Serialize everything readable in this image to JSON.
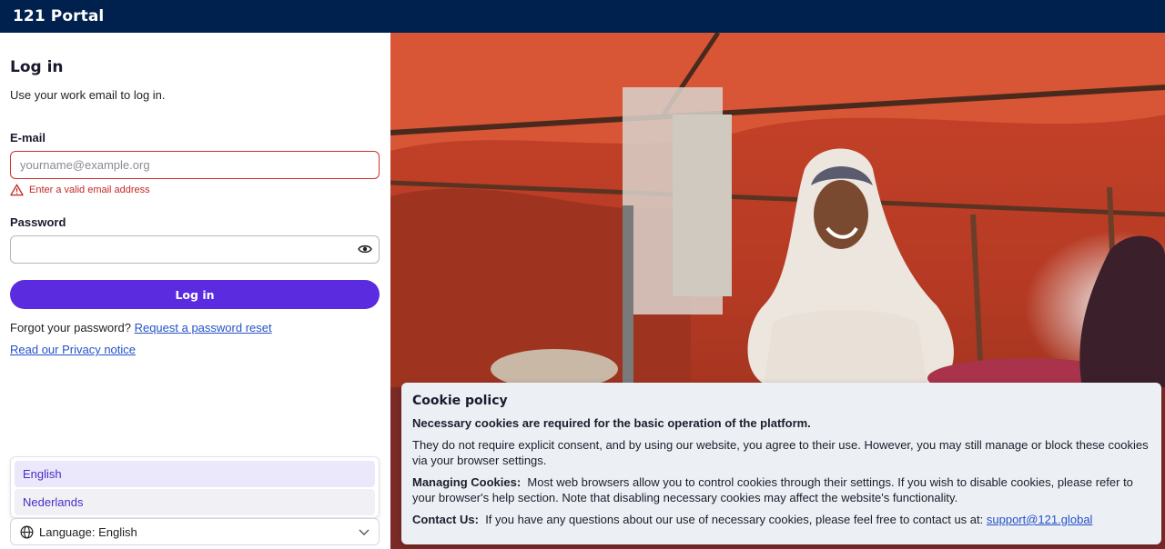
{
  "header": {
    "brand": "121 Portal"
  },
  "login": {
    "title": "Log in",
    "subtitle": "Use your work email to log in.",
    "email_label": "E-mail",
    "email_placeholder": "yourname@example.org",
    "email_value": "",
    "email_error": "Enter a valid email address",
    "password_label": "Password",
    "password_value": "",
    "submit_label": "Log in",
    "forgot_text": "Forgot your password?",
    "reset_link": "Request a password reset",
    "privacy_link": "Read our Privacy notice"
  },
  "language": {
    "options": [
      "English",
      "Nederlands"
    ],
    "selected": "English",
    "select_label": "Language: English"
  },
  "cookie": {
    "title": "Cookie policy",
    "lead": "Necessary cookies are required for the basic operation of the platform.",
    "consent": "They do not require explicit consent, and by using our website, you agree to their use. However, you may still manage or block these cookies via your browser settings.",
    "managing_label": "Managing Cookies:",
    "managing_text": "Most web browsers allow you to control cookies through their settings. If you wish to disable cookies, please refer to your browser's help section. Note that disabling necessary cookies may affect the website's functionality.",
    "contact_label": "Contact Us:",
    "contact_text": "If you have any questions about our use of necessary cookies, please feel free to contact us at:",
    "contact_email": "support@121.global"
  },
  "colors": {
    "header_bg": "#00214d",
    "primary": "#5b2be0",
    "error": "#c62828",
    "link": "#2452c8"
  },
  "icons": [
    "warning-icon",
    "eye-icon",
    "globe-icon",
    "chevron-down-icon"
  ]
}
